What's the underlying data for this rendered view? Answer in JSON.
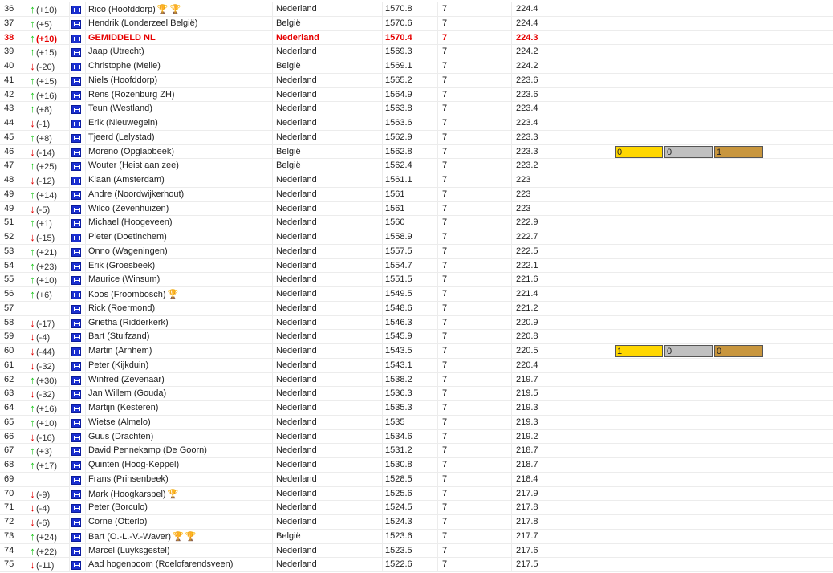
{
  "rows": [
    {
      "rank": "36",
      "dir": "up",
      "delta": "(+10)",
      "name": "Rico (Hoofddorp)",
      "trophies": [
        "gold",
        "bronze"
      ],
      "country": "Nederland",
      "score": "1570.8",
      "games": "7",
      "avg": "224.4"
    },
    {
      "rank": "37",
      "dir": "up",
      "delta": "(+5)",
      "name": "Hendrik (Londerzeel België)",
      "trophies": [],
      "country": "België",
      "score": "1570.6",
      "games": "7",
      "avg": "224.4"
    },
    {
      "rank": "38",
      "dir": "up",
      "delta": "(+10)",
      "name": "GEMIDDELD NL",
      "trophies": [],
      "country": "Nederland",
      "score": "1570.4",
      "games": "7",
      "avg": "224.3",
      "highlight": true
    },
    {
      "rank": "39",
      "dir": "up",
      "delta": "(+15)",
      "name": "Jaap (Utrecht)",
      "trophies": [],
      "country": "Nederland",
      "score": "1569.3",
      "games": "7",
      "avg": "224.2"
    },
    {
      "rank": "40",
      "dir": "down",
      "delta": "(-20)",
      "name": "Christophe (Melle)",
      "trophies": [],
      "country": "België",
      "score": "1569.1",
      "games": "7",
      "avg": "224.2"
    },
    {
      "rank": "41",
      "dir": "up",
      "delta": "(+15)",
      "name": "Niels (Hoofddorp)",
      "trophies": [],
      "country": "Nederland",
      "score": "1565.2",
      "games": "7",
      "avg": "223.6"
    },
    {
      "rank": "42",
      "dir": "up",
      "delta": "(+16)",
      "name": "Rens (Rozenburg ZH)",
      "trophies": [],
      "country": "Nederland",
      "score": "1564.9",
      "games": "7",
      "avg": "223.6"
    },
    {
      "rank": "43",
      "dir": "up",
      "delta": "(+8)",
      "name": "Teun (Westland)",
      "trophies": [],
      "country": "Nederland",
      "score": "1563.8",
      "games": "7",
      "avg": "223.4"
    },
    {
      "rank": "44",
      "dir": "down",
      "delta": "(-1)",
      "name": "Erik (Nieuwegein)",
      "trophies": [],
      "country": "Nederland",
      "score": "1563.6",
      "games": "7",
      "avg": "223.4"
    },
    {
      "rank": "45",
      "dir": "up",
      "delta": "(+8)",
      "name": "Tjeerd (Lelystad)",
      "trophies": [],
      "country": "Nederland",
      "score": "1562.9",
      "games": "7",
      "avg": "223.3"
    },
    {
      "rank": "46",
      "dir": "down",
      "delta": "(-14)",
      "name": "Moreno (Opglabbeek)",
      "trophies": [],
      "country": "België",
      "score": "1562.8",
      "games": "7",
      "avg": "223.3",
      "medals": [
        "0",
        "0",
        "1"
      ]
    },
    {
      "rank": "47",
      "dir": "up",
      "delta": "(+25)",
      "name": "Wouter (Heist aan zee)",
      "trophies": [],
      "country": "België",
      "score": "1562.4",
      "games": "7",
      "avg": "223.2"
    },
    {
      "rank": "48",
      "dir": "down",
      "delta": "(-12)",
      "name": "Klaan (Amsterdam)",
      "trophies": [],
      "country": "Nederland",
      "score": "1561.1",
      "games": "7",
      "avg": "223"
    },
    {
      "rank": "49",
      "dir": "up",
      "delta": "(+14)",
      "name": "Andre (Noordwijkerhout)",
      "trophies": [],
      "country": "Nederland",
      "score": "1561",
      "games": "7",
      "avg": "223"
    },
    {
      "rank": "49",
      "dir": "down",
      "delta": "(-5)",
      "name": "Wilco (Zevenhuizen)",
      "trophies": [],
      "country": "Nederland",
      "score": "1561",
      "games": "7",
      "avg": "223"
    },
    {
      "rank": "51",
      "dir": "up",
      "delta": "(+1)",
      "name": "Michael (Hoogeveen)",
      "trophies": [],
      "country": "Nederland",
      "score": "1560",
      "games": "7",
      "avg": "222.9"
    },
    {
      "rank": "52",
      "dir": "down",
      "delta": "(-15)",
      "name": "Pieter (Doetinchem)",
      "trophies": [],
      "country": "Nederland",
      "score": "1558.9",
      "games": "7",
      "avg": "222.7"
    },
    {
      "rank": "53",
      "dir": "up",
      "delta": "(+21)",
      "name": "Onno (Wageningen)",
      "trophies": [],
      "country": "Nederland",
      "score": "1557.5",
      "games": "7",
      "avg": "222.5"
    },
    {
      "rank": "54",
      "dir": "up",
      "delta": "(+23)",
      "name": "Erik (Groesbeek)",
      "trophies": [],
      "country": "Nederland",
      "score": "1554.7",
      "games": "7",
      "avg": "222.1"
    },
    {
      "rank": "55",
      "dir": "up",
      "delta": "(+10)",
      "name": "Maurice (Winsum)",
      "trophies": [],
      "country": "Nederland",
      "score": "1551.5",
      "games": "7",
      "avg": "221.6"
    },
    {
      "rank": "56",
      "dir": "up",
      "delta": "(+6)",
      "name": "Koos (Froombosch)",
      "trophies": [
        "gold"
      ],
      "country": "Nederland",
      "score": "1549.5",
      "games": "7",
      "avg": "221.4"
    },
    {
      "rank": "57",
      "dir": "none",
      "delta": "",
      "name": "Rick (Roermond)",
      "trophies": [],
      "country": "Nederland",
      "score": "1548.6",
      "games": "7",
      "avg": "221.2"
    },
    {
      "rank": "58",
      "dir": "down",
      "delta": "(-17)",
      "name": "Grietha (Ridderkerk)",
      "trophies": [],
      "country": "Nederland",
      "score": "1546.3",
      "games": "7",
      "avg": "220.9"
    },
    {
      "rank": "59",
      "dir": "down",
      "delta": "(-4)",
      "name": "Bart (Stuifzand)",
      "trophies": [],
      "country": "Nederland",
      "score": "1545.9",
      "games": "7",
      "avg": "220.8"
    },
    {
      "rank": "60",
      "dir": "down",
      "delta": "(-44)",
      "name": "Martin (Arnhem)",
      "trophies": [],
      "country": "Nederland",
      "score": "1543.5",
      "games": "7",
      "avg": "220.5",
      "medals": [
        "1",
        "0",
        "0"
      ]
    },
    {
      "rank": "61",
      "dir": "down",
      "delta": "(-32)",
      "name": "Peter (Kijkduin)",
      "trophies": [],
      "country": "Nederland",
      "score": "1543.1",
      "games": "7",
      "avg": "220.4"
    },
    {
      "rank": "62",
      "dir": "up",
      "delta": "(+30)",
      "name": "Winfred (Zevenaar)",
      "trophies": [],
      "country": "Nederland",
      "score": "1538.2",
      "games": "7",
      "avg": "219.7"
    },
    {
      "rank": "63",
      "dir": "down",
      "delta": "(-32)",
      "name": "Jan Willem (Gouda)",
      "trophies": [],
      "country": "Nederland",
      "score": "1536.3",
      "games": "7",
      "avg": "219.5"
    },
    {
      "rank": "64",
      "dir": "up",
      "delta": "(+16)",
      "name": "Martijn (Kesteren)",
      "trophies": [],
      "country": "Nederland",
      "score": "1535.3",
      "games": "7",
      "avg": "219.3"
    },
    {
      "rank": "65",
      "dir": "up",
      "delta": "(+10)",
      "name": "Wietse (Almelo)",
      "trophies": [],
      "country": "Nederland",
      "score": "1535",
      "games": "7",
      "avg": "219.3"
    },
    {
      "rank": "66",
      "dir": "down",
      "delta": "(-16)",
      "name": "Guus (Drachten)",
      "trophies": [],
      "country": "Nederland",
      "score": "1534.6",
      "games": "7",
      "avg": "219.2"
    },
    {
      "rank": "67",
      "dir": "up",
      "delta": "(+3)",
      "name": "David Pennekamp (De Goorn)",
      "trophies": [],
      "country": "Nederland",
      "score": "1531.2",
      "games": "7",
      "avg": "218.7"
    },
    {
      "rank": "68",
      "dir": "up",
      "delta": "(+17)",
      "name": "Quinten (Hoog-Keppel)",
      "trophies": [],
      "country": "Nederland",
      "score": "1530.8",
      "games": "7",
      "avg": "218.7"
    },
    {
      "rank": "69",
      "dir": "none",
      "delta": "",
      "name": "Frans (Prinsenbeek)",
      "trophies": [],
      "country": "Nederland",
      "score": "1528.5",
      "games": "7",
      "avg": "218.4"
    },
    {
      "rank": "70",
      "dir": "down",
      "delta": "(-9)",
      "name": "Mark (Hoogkarspel)",
      "trophies": [
        "silver"
      ],
      "country": "Nederland",
      "score": "1525.6",
      "games": "7",
      "avg": "217.9"
    },
    {
      "rank": "71",
      "dir": "down",
      "delta": "(-4)",
      "name": "Peter (Borculo)",
      "trophies": [],
      "country": "Nederland",
      "score": "1524.5",
      "games": "7",
      "avg": "217.8"
    },
    {
      "rank": "72",
      "dir": "down",
      "delta": "(-6)",
      "name": "Corne (Otterlo)",
      "trophies": [],
      "country": "Nederland",
      "score": "1524.3",
      "games": "7",
      "avg": "217.8"
    },
    {
      "rank": "73",
      "dir": "up",
      "delta": "(+24)",
      "name": "Bart (O.-L.-V.-Waver)",
      "trophies": [
        "gold",
        "gold"
      ],
      "country": "België",
      "score": "1523.6",
      "games": "7",
      "avg": "217.7"
    },
    {
      "rank": "74",
      "dir": "up",
      "delta": "(+22)",
      "name": "Marcel (Luyksgestel)",
      "trophies": [],
      "country": "Nederland",
      "score": "1523.5",
      "games": "7",
      "avg": "217.6"
    },
    {
      "rank": "75",
      "dir": "down",
      "delta": "(-11)",
      "name": "Aad hogenboom (Roelofarendsveen)",
      "trophies": [],
      "country": "Nederland",
      "score": "1522.6",
      "games": "7",
      "avg": "217.5"
    }
  ],
  "icons": {
    "up": "arrow-up-icon",
    "down": "arrow-down-icon",
    "team": "player-flag-icon",
    "trophy": "trophy-icon"
  },
  "colors": {
    "up": "#19c419",
    "down": "#e00000",
    "highlight": "#e60000",
    "gold": "#ffd700",
    "silver": "#c0c0c0",
    "bronze": "#c8963e"
  }
}
